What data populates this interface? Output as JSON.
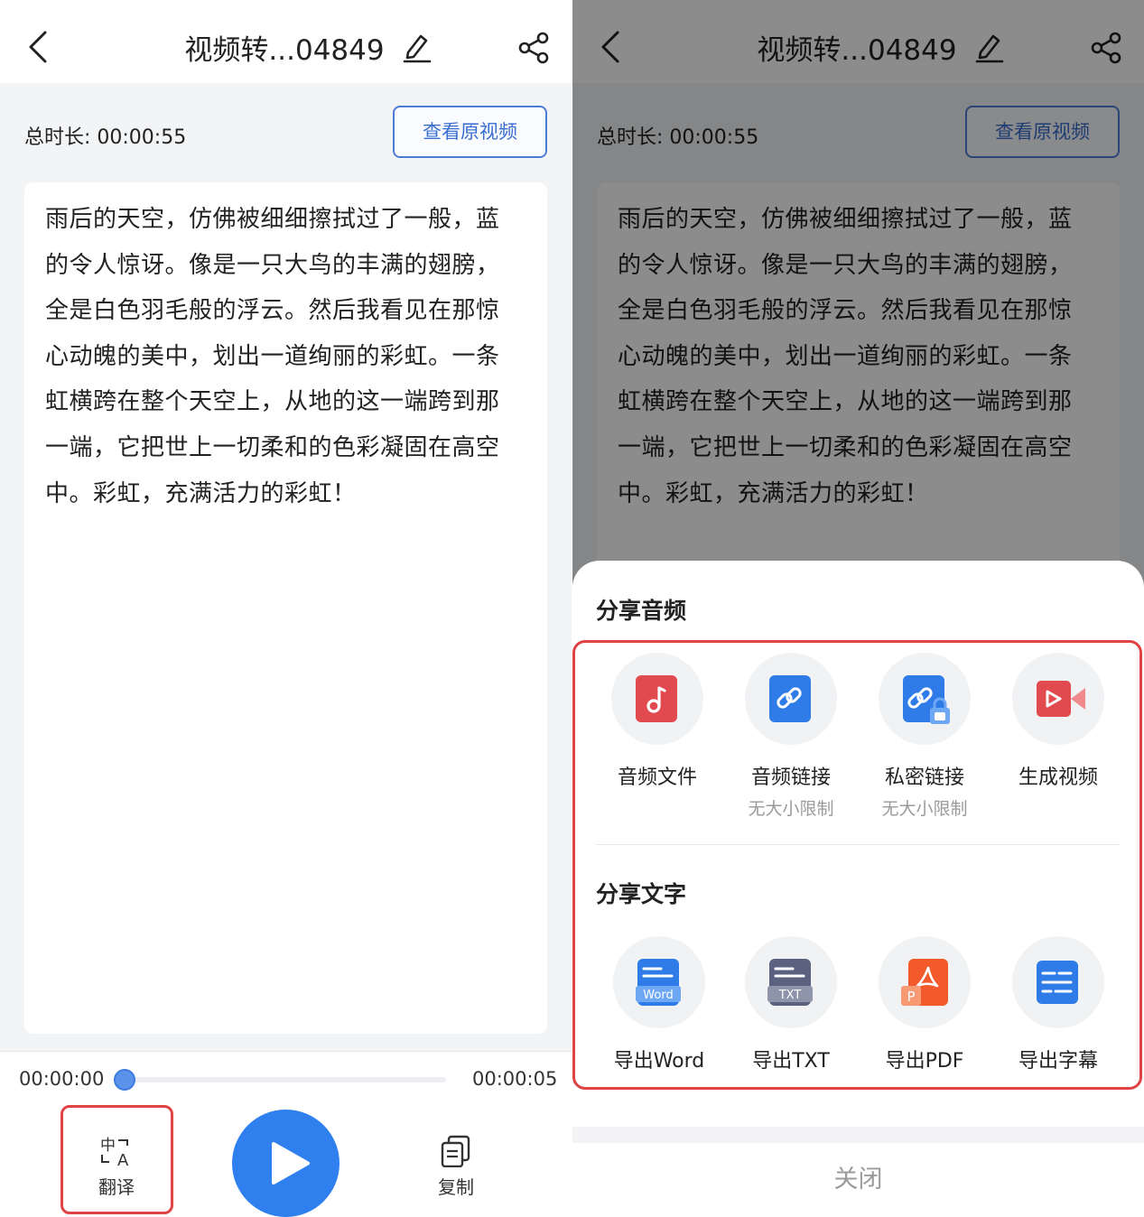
{
  "header": {
    "title": "视频转...04849"
  },
  "info": {
    "duration_text": "总时长: 00:00:55",
    "view_video_label": "查看原视频"
  },
  "transcript": {
    "lines": [
      "雨后的天空，仿佛被细细擦拭过了一般，蓝",
      "的令人惊讶。像是一只大鸟的丰满的翅膀，",
      "全是白色羽毛般的浮云。然后我看见在那惊",
      "心动魄的美中，划出一道绚丽的彩虹。一条",
      "虹横跨在整个天空上，从地的这一端跨到那",
      "一端，它把世上一切柔和的色彩凝固在高空",
      "中。彩虹，充满活力的彩虹！"
    ]
  },
  "player": {
    "current_time": "00:00:00",
    "total_time": "00:00:05",
    "progress": 0.0,
    "translate_label": "翻译",
    "copy_label": "复制"
  },
  "share_sheet": {
    "audio_section_title": "分享音频",
    "audio_options": [
      {
        "label": "音频文件",
        "sublabel": "",
        "icon": "music-note-icon"
      },
      {
        "label": "音频链接",
        "sublabel": "无大小限制",
        "icon": "link-icon"
      },
      {
        "label": "私密链接",
        "sublabel": "无大小限制",
        "icon": "private-link-icon"
      },
      {
        "label": "生成视频",
        "sublabel": "",
        "icon": "video-camera-icon"
      }
    ],
    "text_section_title": "分享文字",
    "text_options": [
      {
        "label": "导出Word",
        "badge": "Word",
        "icon": "word-doc-icon"
      },
      {
        "label": "导出TXT",
        "badge": "TXT",
        "icon": "txt-doc-icon"
      },
      {
        "label": "导出PDF",
        "badge": "P",
        "icon": "pdf-doc-icon"
      },
      {
        "label": "导出字幕",
        "badge": "",
        "icon": "subtitle-icon"
      }
    ],
    "close_label": "关闭"
  },
  "colors": {
    "accent": "#2f80ee",
    "highlight_border": "#e04343",
    "audio_file_icon": "#e14b4f",
    "link_icon": "#2f7be8",
    "video_icon": "#e14b4f",
    "txt_icon": "#5a6280",
    "pdf_icon": "#f25a2c"
  }
}
